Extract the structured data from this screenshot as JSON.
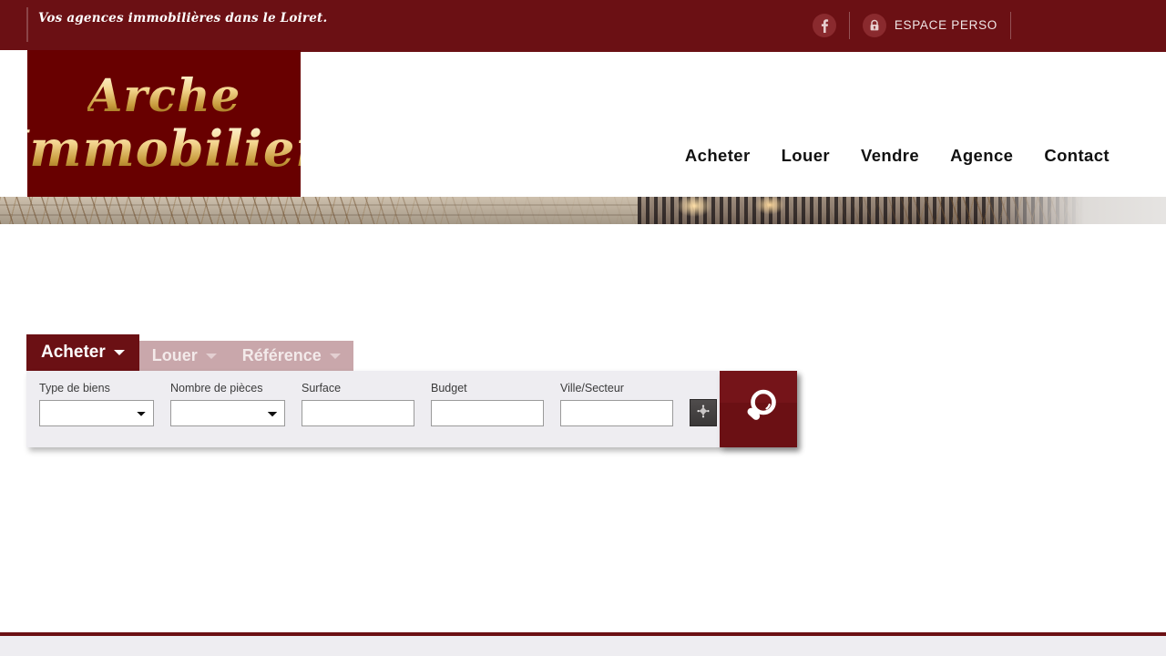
{
  "topbar": {
    "tagline": "Vos agences immobilières dans le Loiret.",
    "facebook_icon": "facebook-icon",
    "lock_icon": "lock-icon",
    "espace_perso_label": "ESPACE PERSO"
  },
  "logo": {
    "line1": "Arche",
    "line2": "Immobilier",
    "alt": "Arche Immobilier"
  },
  "nav": {
    "items": [
      {
        "label": "Acheter"
      },
      {
        "label": "Louer"
      },
      {
        "label": "Vendre"
      },
      {
        "label": "Agence"
      },
      {
        "label": "Contact"
      }
    ]
  },
  "search": {
    "tabs": [
      {
        "label": "Acheter",
        "active": true
      },
      {
        "label": "Louer",
        "active": false
      },
      {
        "label": "Référence",
        "active": false
      }
    ],
    "fields": {
      "type": {
        "label": "Type de biens",
        "value": "",
        "options": [
          ""
        ]
      },
      "pieces": {
        "label": "Nombre de pièces",
        "value": "",
        "options": [
          ""
        ]
      },
      "surface": {
        "label": "Surface",
        "value": "",
        "placeholder": ""
      },
      "budget": {
        "label": "Budget",
        "value": "",
        "placeholder": ""
      },
      "ville": {
        "label": "Ville/Secteur",
        "value": "",
        "placeholder": ""
      }
    },
    "geo_icon": "location-star-icon",
    "submit_icon": "magnifier-icon"
  },
  "colors": {
    "brand_red": "#6b1014",
    "logo_red": "#680000",
    "tab_inactive": "#c9a7ab",
    "panel_bg": "#eeedf1",
    "gold": "#f3d48d"
  }
}
